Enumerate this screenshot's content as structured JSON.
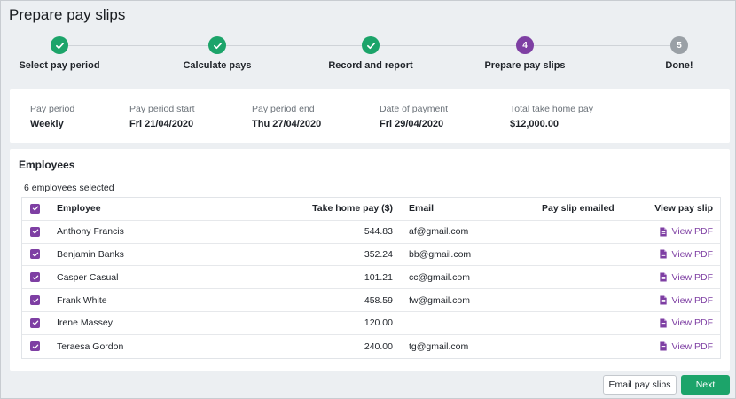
{
  "page": {
    "title": "Prepare pay slips"
  },
  "stepper": {
    "steps": [
      {
        "label": "Select pay period",
        "state": "done",
        "number": ""
      },
      {
        "label": "Calculate pays",
        "state": "done",
        "number": ""
      },
      {
        "label": "Record and report",
        "state": "done",
        "number": ""
      },
      {
        "label": "Prepare pay slips",
        "state": "current",
        "number": "4"
      },
      {
        "label": "Done!",
        "state": "todo",
        "number": "5"
      }
    ]
  },
  "summary": {
    "pay_period": {
      "label": "Pay period",
      "value": "Weekly"
    },
    "period_start": {
      "label": "Pay period start",
      "value": "Fri 21/04/2020"
    },
    "period_end": {
      "label": "Pay period end",
      "value": "Thu 27/04/2020"
    },
    "payment_date": {
      "label": "Date of payment",
      "value": "Fri 29/04/2020"
    },
    "total": {
      "label": "Total take home pay",
      "value": "$12,000.00"
    }
  },
  "employees": {
    "title": "Employees",
    "selected_text": "6 employees selected",
    "columns": {
      "employee": "Employee",
      "take_home": "Take home pay ($)",
      "email": "Email",
      "emailed": "Pay slip emailed",
      "view": "View pay slip"
    },
    "view_label": "View PDF",
    "rows": [
      {
        "name": "Anthony Francis",
        "pay": "544.83",
        "email": "af@gmail.com",
        "emailed": ""
      },
      {
        "name": "Benjamin Banks",
        "pay": "352.24",
        "email": "bb@gmail.com",
        "emailed": ""
      },
      {
        "name": "Casper Casual",
        "pay": "101.21",
        "email": "cc@gmail.com",
        "emailed": ""
      },
      {
        "name": "Frank White",
        "pay": "458.59",
        "email": "fw@gmail.com",
        "emailed": ""
      },
      {
        "name": "Irene Massey",
        "pay": "120.00",
        "email": "",
        "emailed": ""
      },
      {
        "name": "Teraesa Gordon",
        "pay": "240.00",
        "email": "tg@gmail.com",
        "emailed": ""
      }
    ]
  },
  "footer": {
    "email_button": "Email pay slips",
    "next_button": "Next"
  },
  "colors": {
    "done": "#1ca46a",
    "current": "#7e3fa3",
    "todo": "#9aa0a6",
    "accent": "#7e3fa3"
  },
  "icons": {
    "step_done": "check-icon",
    "checkbox": "check-icon",
    "view": "pdf-document-icon"
  }
}
